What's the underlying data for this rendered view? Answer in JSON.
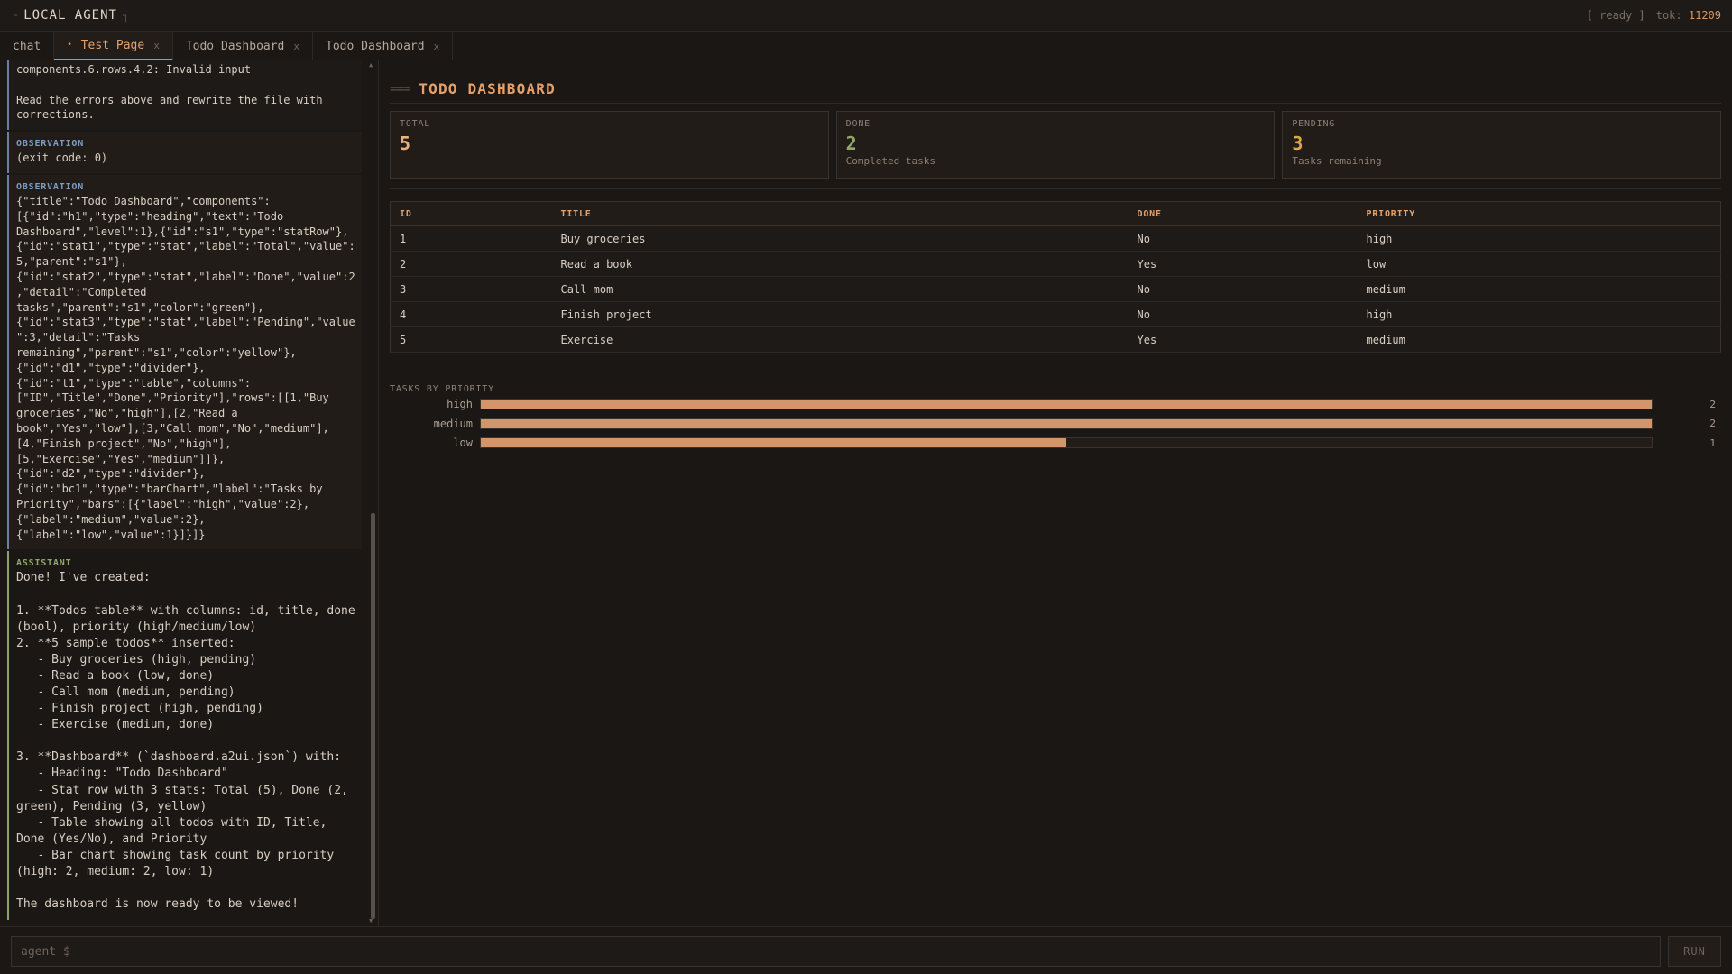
{
  "header": {
    "title": "LOCAL AGENT",
    "status": "[ ready ]",
    "tok_label": "tok:",
    "tok_value": "11209"
  },
  "tabs": [
    {
      "label": "chat",
      "active": false
    },
    {
      "label": "Test Page",
      "active": true
    },
    {
      "label": "Todo Dashboard",
      "active": false
    },
    {
      "label": "Todo Dashboard",
      "active": false
    }
  ],
  "chat": {
    "error_text": "components.6.rows.4.2: Invalid input\n\nRead the errors above and rewrite the file with\ncorrections.",
    "obs1_label": "OBSERVATION",
    "obs1_text": "(exit code: 0)",
    "obs2_label": "OBSERVATION",
    "obs2_text": "{\"title\":\"Todo Dashboard\",\"components\":\n[{\"id\":\"h1\",\"type\":\"heading\",\"text\":\"Todo\nDashboard\",\"level\":1},{\"id\":\"s1\",\"type\":\"statRow\"},\n{\"id\":\"stat1\",\"type\":\"stat\",\"label\":\"Total\",\"value\":\n5,\"parent\":\"s1\"},\n{\"id\":\"stat2\",\"type\":\"stat\",\"label\":\"Done\",\"value\":2\n,\"detail\":\"Completed\ntasks\",\"parent\":\"s1\",\"color\":\"green\"},\n{\"id\":\"stat3\",\"type\":\"stat\",\"label\":\"Pending\",\"value\n\":3,\"detail\":\"Tasks\nremaining\",\"parent\":\"s1\",\"color\":\"yellow\"},\n{\"id\":\"d1\",\"type\":\"divider\"},\n{\"id\":\"t1\",\"type\":\"table\",\"columns\":\n[\"ID\",\"Title\",\"Done\",\"Priority\"],\"rows\":[[1,\"Buy\ngroceries\",\"No\",\"high\"],[2,\"Read a\nbook\",\"Yes\",\"low\"],[3,\"Call mom\",\"No\",\"medium\"],\n[4,\"Finish project\",\"No\",\"high\"],\n[5,\"Exercise\",\"Yes\",\"medium\"]]},\n{\"id\":\"d2\",\"type\":\"divider\"},\n{\"id\":\"bc1\",\"type\":\"barChart\",\"label\":\"Tasks by\nPriority\",\"bars\":[{\"label\":\"high\",\"value\":2},\n{\"label\":\"medium\",\"value\":2},\n{\"label\":\"low\",\"value\":1}]}]}",
    "assistant_label": "ASSISTANT",
    "assistant_text": "Done! I've created:\n\n1. **Todos table** with columns: id, title, done\n(bool), priority (high/medium/low)\n2. **5 sample todos** inserted:\n   - Buy groceries (high, pending)\n   - Read a book (low, done)\n   - Call mom (medium, pending)\n   - Finish project (high, pending)\n   - Exercise (medium, done)\n\n3. **Dashboard** (`dashboard.a2ui.json`) with:\n   - Heading: \"Todo Dashboard\"\n   - Stat row with 3 stats: Total (5), Done (2,\ngreen), Pending (3, yellow)\n   - Table showing all todos with ID, Title,\nDone (Yes/No), and Priority\n   - Bar chart showing task count by priority\n(high: 2, medium: 2, low: 1)\n\nThe dashboard is now ready to be viewed!"
  },
  "dashboard": {
    "title_marks": "===",
    "title": "TODO DASHBOARD",
    "stats": [
      {
        "label": "TOTAL",
        "value": "5",
        "detail": "",
        "color": "#e8b07a"
      },
      {
        "label": "DONE",
        "value": "2",
        "detail": "Completed tasks",
        "color": "#8fa86a"
      },
      {
        "label": "PENDING",
        "value": "3",
        "detail": "Tasks remaining",
        "color": "#d9a843"
      }
    ],
    "table": {
      "columns": [
        "ID",
        "TITLE",
        "DONE",
        "PRIORITY"
      ],
      "rows": [
        [
          "1",
          "Buy groceries",
          "No",
          "high"
        ],
        [
          "2",
          "Read a book",
          "Yes",
          "low"
        ],
        [
          "3",
          "Call mom",
          "No",
          "medium"
        ],
        [
          "4",
          "Finish project",
          "No",
          "high"
        ],
        [
          "5",
          "Exercise",
          "Yes",
          "medium"
        ]
      ]
    }
  },
  "chart_data": {
    "type": "bar",
    "title": "TASKS BY PRIORITY",
    "categories": [
      "high",
      "medium",
      "low"
    ],
    "values": [
      2,
      2,
      1
    ],
    "ylim": [
      0,
      2
    ],
    "fill_color": "#d4956a"
  },
  "input": {
    "placeholder": "agent $",
    "run_label": "RUN"
  }
}
